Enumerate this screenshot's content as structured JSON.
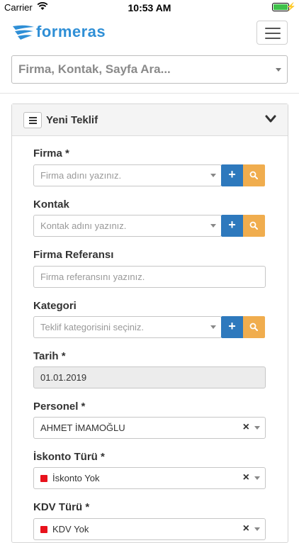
{
  "status": {
    "carrier": "Carrier",
    "time": "10:53 AM"
  },
  "app": {
    "logo_text": "formeras",
    "brand_color": "#2f8fd6"
  },
  "search": {
    "placeholder": "Firma, Kontak, Sayfa Ara..."
  },
  "panel": {
    "title": "Yeni Teklif"
  },
  "form": {
    "firma": {
      "label": "Firma *",
      "placeholder": "Firma adını yazınız."
    },
    "kontak": {
      "label": "Kontak",
      "placeholder": "Kontak adını yazınız."
    },
    "referans": {
      "label": "Firma Referansı",
      "placeholder": "Firma referansını yazınız."
    },
    "kategori": {
      "label": "Kategori",
      "placeholder": "Teklif kategorisini seçiniz."
    },
    "tarih": {
      "label": "Tarih *",
      "value": "01.01.2019"
    },
    "personel": {
      "label": "Personel *",
      "value": "AHMET İMAMOĞLU"
    },
    "iskonto": {
      "label": "İskonto Türü *",
      "value": "İskonto Yok"
    },
    "kdv": {
      "label": "KDV Türü *",
      "value": "KDV Yok"
    }
  },
  "colors": {
    "add_button": "#2e79bd",
    "search_button": "#f0ad4e",
    "status_square": "#e8121c"
  },
  "icons": {
    "add": "+",
    "clear": "×"
  }
}
